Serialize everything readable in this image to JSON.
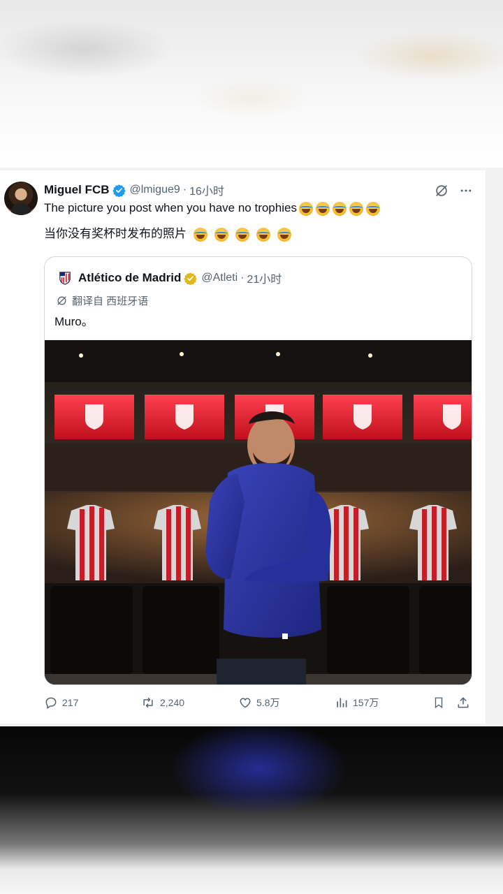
{
  "author": {
    "name": "Miguel FCB",
    "handle": "@lmigue9",
    "separator": "·",
    "time": "16小时",
    "text_en": "The picture you post when you have no trophies",
    "text_zh": "当你没有奖杯时发布的照片"
  },
  "quoted": {
    "name": "Atlético de Madrid",
    "handle": "@Atleti",
    "separator": "·",
    "time": "21小时",
    "translate_label": "翻译自 西班牙语",
    "text": "Muro。"
  },
  "actions": {
    "replies": "217",
    "reposts": "2,240",
    "likes": "5.8万",
    "views": "157万"
  },
  "colors": {
    "verified_blue": "#1d9bf0",
    "verified_gold": "#e2b719",
    "text_primary": "#0f1419",
    "text_secondary": "#536471"
  },
  "icons": [
    "verified-badge-icon",
    "grok-icon",
    "more-icon",
    "translate-icon",
    "reply-icon",
    "repost-icon",
    "like-icon",
    "views-icon",
    "bookmark-icon",
    "share-icon"
  ]
}
